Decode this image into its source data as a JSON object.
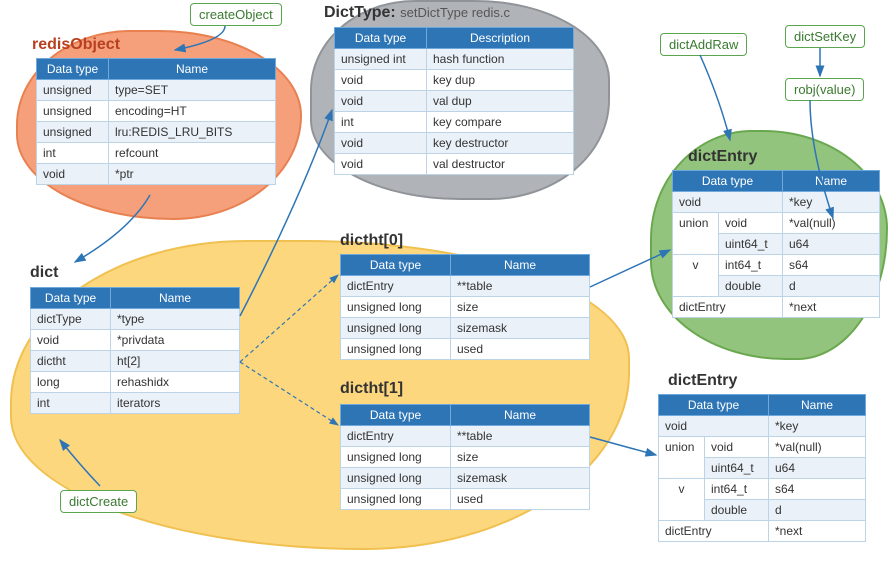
{
  "labels": {
    "createObject": "createObject",
    "dictCreate": "dictCreate",
    "dictAddRaw": "dictAddRaw",
    "dictSetKey": "dictSetKey",
    "robjValue": "robj(value)"
  },
  "titles": {
    "redisObject": "redisObject",
    "dictType": "DictType:",
    "dictTypeSub": "setDictType  redis.c",
    "dict": "dict",
    "dictht0": "dictht[0]",
    "dictht1": "dictht[1]",
    "dictEntry1": "dictEntry",
    "dictEntry2": "dictEntry"
  },
  "headers": {
    "dataType": "Data type",
    "name": "Name",
    "description": "Description"
  },
  "redisObject": [
    [
      "unsigned",
      "type=SET"
    ],
    [
      "unsigned",
      "encoding=HT"
    ],
    [
      "unsigned",
      "lru:REDIS_LRU_BITS"
    ],
    [
      "int",
      "refcount"
    ],
    [
      "void",
      "*ptr"
    ]
  ],
  "dictType": [
    [
      "unsigned int",
      "hash function"
    ],
    [
      "void",
      "key dup"
    ],
    [
      "void",
      "val dup"
    ],
    [
      "int",
      "key compare"
    ],
    [
      "void",
      "key destructor"
    ],
    [
      "void",
      "val destructor"
    ]
  ],
  "dict": [
    [
      "dictType",
      "*type"
    ],
    [
      "void",
      "*privdata"
    ],
    [
      "dictht",
      "ht[2]"
    ],
    [
      "long",
      "rehashidx"
    ],
    [
      "int",
      "iterators"
    ]
  ],
  "dictht": [
    [
      "dictEntry",
      "**table"
    ],
    [
      "unsigned long",
      "size"
    ],
    [
      "unsigned long",
      "sizemask"
    ],
    [
      "unsigned long",
      "used"
    ]
  ],
  "dictEntry": {
    "r1": [
      "void",
      "*key"
    ],
    "r2_c1": "union",
    "r2_c2": "void",
    "r2_c3": "*val(null)",
    "r3_c1": "v",
    "r3_c2": "uint64_t",
    "r3_c3": "u64",
    "r4_c2": "int64_t",
    "r4_c3": "s64",
    "r5_c2": "double",
    "r5_c3": "d",
    "r6": [
      "dictEntry",
      "*next"
    ]
  }
}
